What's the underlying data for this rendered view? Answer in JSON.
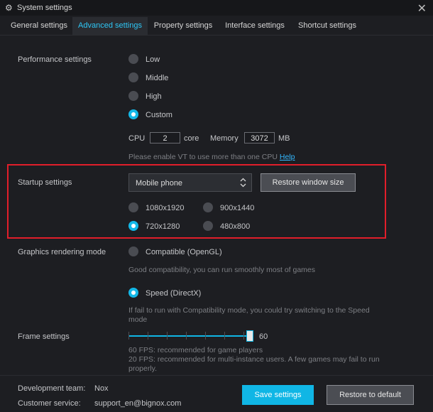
{
  "window": {
    "title": "System settings",
    "icon": "gear-icon",
    "close": "✕"
  },
  "tabs": [
    {
      "label": "General settings"
    },
    {
      "label": "Advanced settings"
    },
    {
      "label": "Property settings"
    },
    {
      "label": "Interface settings"
    },
    {
      "label": "Shortcut settings"
    }
  ],
  "performance": {
    "label": "Performance settings",
    "options": [
      "Low",
      "Middle",
      "High",
      "Custom"
    ],
    "selected": "Custom",
    "cpu_label": "CPU",
    "cpu_value": "2",
    "cpu_unit": "core",
    "memory_label": "Memory",
    "memory_value": "3072",
    "memory_unit": "MB",
    "vt_note": "Please enable VT to use more than one CPU",
    "help_link": "Help"
  },
  "startup": {
    "label": "Startup settings",
    "device_selected": "Mobile phone",
    "restore_button": "Restore window size",
    "resolutions": [
      "1080x1920",
      "900x1440",
      "720x1280",
      "480x800"
    ],
    "selected_resolution": "720x1280"
  },
  "graphics": {
    "label": "Graphics rendering mode",
    "opt1": "Compatible (OpenGL)",
    "opt1_desc": "Good compatibility, you can run smoothly most of games",
    "opt2": "Speed (DirectX)",
    "opt2_desc_1": " If fail to run with Compatibility mode, you could try switching to the Speed",
    "opt2_desc_2": "mode",
    "selected": "Speed (DirectX)"
  },
  "frame": {
    "label": "Frame settings",
    "value": "60",
    "desc1": "60 FPS: recommended for game players",
    "desc2": "20 FPS: recommended for multi-instance users. A few games may fail to run",
    "desc3": "properly."
  },
  "footer": {
    "dev_label": "Development team:",
    "dev_value": "Nox",
    "cs_label": "Customer service:",
    "cs_value": "support_en@bignox.com",
    "save_button": "Save settings",
    "restore_default_button": "Restore to default"
  },
  "colors": {
    "accent": "#10b6e5",
    "highlight_border": "#e11e2a",
    "background": "#1d1e22"
  }
}
